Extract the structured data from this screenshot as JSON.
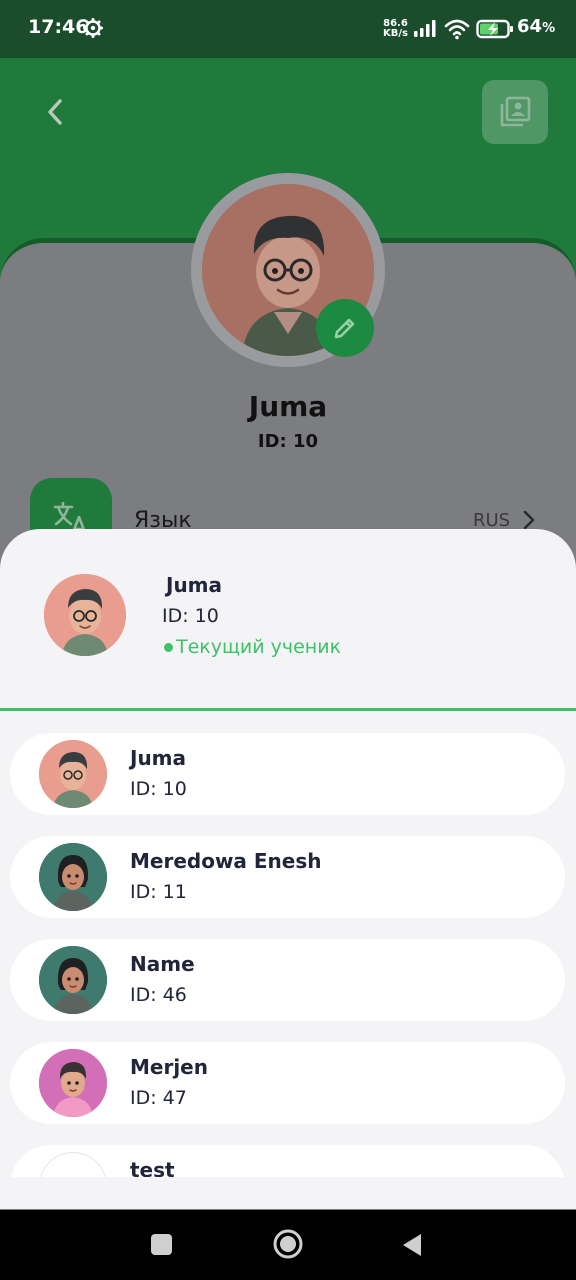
{
  "status_bar": {
    "time": "17:46",
    "net_speed_value": "86.6",
    "net_speed_unit": "KB/s",
    "battery_percent": "64",
    "battery_unit": "%"
  },
  "profile": {
    "name": "Juma",
    "id_label": "ID: 10"
  },
  "settings": {
    "language_label": "Язык",
    "language_value": "RUS"
  },
  "current_student": {
    "name": "Juma",
    "id_label": "ID: 10",
    "status": "Текущий ученик"
  },
  "students": [
    {
      "name": "Juma",
      "id_label": "ID: 10",
      "avatar_bg": "#e89d8e"
    },
    {
      "name": "Meredowa Enesh",
      "id_label": "ID: 11",
      "avatar_bg": "#3f7a6e"
    },
    {
      "name": "Name",
      "id_label": "ID: 46",
      "avatar_bg": "#3f7a6e"
    },
    {
      "name": "Merjen",
      "id_label": "ID: 47",
      "avatar_bg": "#d26fb6"
    },
    {
      "name": "test",
      "id_label": "",
      "avatar_bg": "#ffffff"
    }
  ],
  "colors": {
    "brand_green": "#1f7a3b",
    "status_green": "#3ec167"
  },
  "icons": [
    "back-arrow-icon",
    "photo-album-icon",
    "pencil-icon",
    "translate-icon",
    "chevron-right-icon",
    "gear-icon",
    "signal-icon",
    "wifi-icon",
    "battery-icon"
  ]
}
